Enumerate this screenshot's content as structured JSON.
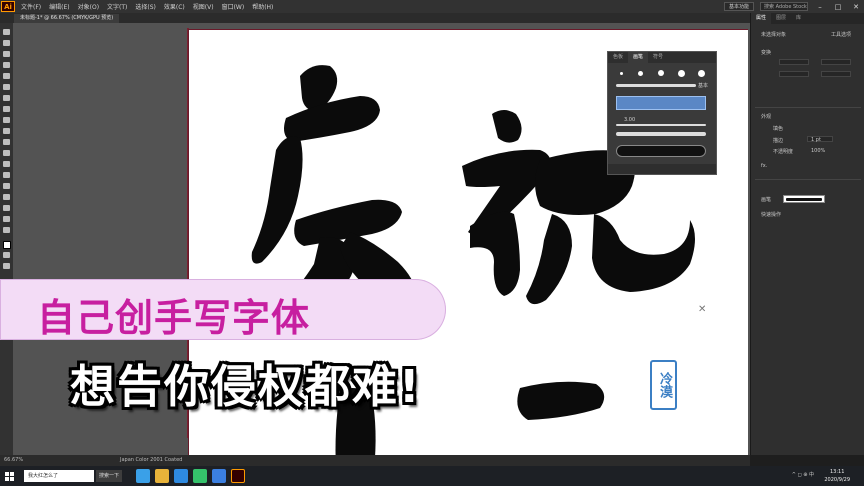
{
  "menubar": {
    "items": [
      "文件(F)",
      "编辑(E)",
      "对象(O)",
      "文字(T)",
      "选择(S)",
      "效果(C)",
      "视图(V)",
      "窗口(W)",
      "帮助(H)"
    ],
    "workspace": "基本功能",
    "search_placeholder": "搜索 Adobe Stock"
  },
  "document_tab": "未标题-1* @ 66.67% (CMYK/GPU 预览)",
  "brush_panel": {
    "tabs": [
      "色板",
      "画笔",
      "符号"
    ],
    "basic_label": "基本",
    "size_value": "3.00"
  },
  "right_panel": {
    "tabs": [
      "属性",
      "图层",
      "库"
    ],
    "no_selection": "未选择对象",
    "tool_label": "工具选项",
    "transform": "变换",
    "appearance": "外观",
    "fill": "填色",
    "stroke": "描边",
    "stroke_weight": "1 pt",
    "opacity": "不透明度",
    "opacity_value": "100%",
    "fx": "fx.",
    "brush_label": "画笔",
    "quick_actions": "快速操作"
  },
  "status": {
    "zoom": "66.67%",
    "profile": "Japan Color 2001 Coated"
  },
  "taskbar": {
    "search_text": "我大红怎么了",
    "search_button": "搜索一下",
    "time": "13:11",
    "date": "2020/9/29"
  },
  "overlay": {
    "title": "自己创手写字体",
    "subtitle": "想告你侵权都难!",
    "seal": "冷漠"
  },
  "colors": {
    "banner_bg": "#f3dcf6",
    "banner_text": "#c71fa0",
    "seal_blue": "#3b7fc4",
    "ai_orange": "#ff9a00"
  }
}
